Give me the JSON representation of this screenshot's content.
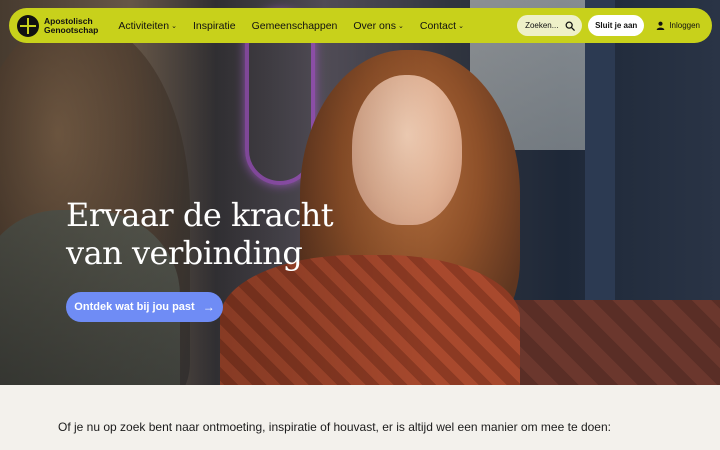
{
  "nav": {
    "logo_line1": "Apostolisch",
    "logo_line2": "Genootschap",
    "items": [
      {
        "label": "Activiteiten",
        "has_dropdown": true
      },
      {
        "label": "Inspiratie",
        "has_dropdown": false
      },
      {
        "label": "Gemeenschappen",
        "has_dropdown": false
      },
      {
        "label": "Over ons",
        "has_dropdown": true
      },
      {
        "label": "Contact",
        "has_dropdown": true
      }
    ],
    "search_placeholder": "Zoeken...",
    "join_label": "Sluit je aan",
    "login_label": "Inloggen",
    "accent_color": "#c8d11b"
  },
  "hero": {
    "title_line1": "Ervaar de kracht",
    "title_line2": "van verbinding",
    "cta_label": "Ontdek wat bij jou past",
    "cta_arrow": "→",
    "cta_color": "#6f8cf5"
  },
  "intro": {
    "text": "Of je nu op zoek bent naar ontmoeting, inspiratie of houvast, er is altijd wel een manier om mee te doen:"
  },
  "icons": {
    "logo": "cross-logo-icon",
    "search": "search-icon",
    "login": "user-icon",
    "dropdown": "chevron-down-icon",
    "cta": "arrow-right-icon"
  }
}
